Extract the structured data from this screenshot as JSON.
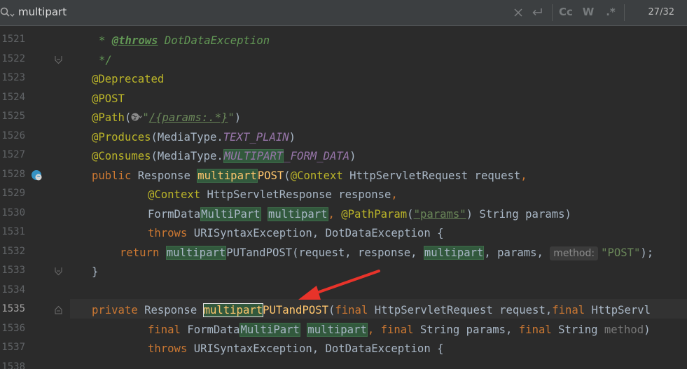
{
  "search": {
    "query": "multipart",
    "match_case_label": "Cc",
    "words_label": "W",
    "regex_label": ".*",
    "counter": "27/32"
  },
  "editor": {
    "lines": [
      {
        "n": "1521"
      },
      {
        "n": "1522"
      },
      {
        "n": "1523"
      },
      {
        "n": "1524"
      },
      {
        "n": "1525"
      },
      {
        "n": "1526"
      },
      {
        "n": "1527"
      },
      {
        "n": "1528"
      },
      {
        "n": "1529"
      },
      {
        "n": "1530"
      },
      {
        "n": "1531"
      },
      {
        "n": "1532"
      },
      {
        "n": "1533"
      },
      {
        "n": "1534"
      },
      {
        "n": "1535"
      },
      {
        "n": "1536"
      },
      {
        "n": "1537"
      },
      {
        "n": "1538"
      }
    ],
    "l1521": {
      "star": "* ",
      "tag": "@throws",
      "rest": " DotDataException"
    },
    "l1522": {
      "text": "*/"
    },
    "l1523": {
      "text": "@Deprecated"
    },
    "l1524": {
      "text": "@POST"
    },
    "l1525": {
      "ann": "@Path",
      "open": "(",
      "q1": "\"",
      "path": "/{params:.*}",
      "q2": "\"",
      "close": ")"
    },
    "l1526": {
      "ann": "@Produces",
      "pre": "(MediaType.",
      "const": "TEXT_PLAIN",
      "post": ")"
    },
    "l1527": {
      "ann": "@Consumes",
      "pre": "(MediaType.",
      "const_hl": "MULTIPART",
      "const": "_FORM_DATA",
      "post": ")"
    },
    "l1528": {
      "kw": "public",
      "type": " Response ",
      "hl": "multipart",
      "meth": "POST",
      "open": "(",
      "ann": "@Context",
      "rest": " HttpServletRequest request",
      "comma": ","
    },
    "l1529": {
      "ann": "@Context",
      "rest": " HttpServletResponse response",
      "comma": ","
    },
    "l1530": {
      "pre": "FormData",
      "hl": "MultiPart",
      "sp": " ",
      "hl2": "multipart",
      "comma": ", ",
      "ann": "@PathParam",
      "open": "(",
      "str": "\"params\"",
      "rest": ") String params)"
    },
    "l1531": {
      "kw": "throws",
      "rest": " URISyntaxException, DotDataException {"
    },
    "l1532": {
      "kw": "return",
      "sp": " ",
      "hl": "multipart",
      "m": "PUTandPOST(request, response, ",
      "hl2": "multipart",
      "rest": ", params, ",
      "hint": "method:",
      "str": "\"POST\"",
      "end": ");"
    },
    "l1533": {
      "text": "}"
    },
    "l1535": {
      "kw": "private",
      "type": " Response ",
      "hl": "multipart",
      "meth": "PUTandPOST",
      "open": "(",
      "kw2": "final",
      "rest": " HttpServletRequest request,",
      "kw3": "final",
      "rest2": " HttpServl"
    },
    "l1536": {
      "kw": "final",
      "pre": " FormData",
      "hl": "MultiPart",
      "sp": " ",
      "hl2": "multipart",
      "comma": ", ",
      "kw2": "final",
      "rest": " String params, ",
      "kw3": "final",
      "rest2": " String ",
      "gray": "method",
      "end": ")"
    },
    "l1537": {
      "kw": "throws",
      "rest": " URISyntaxException, DotDataException {"
    }
  },
  "colors": {
    "background": "#2b2b2b",
    "keyword": "#cc7832",
    "annotation": "#bbb529",
    "string": "#6a8759",
    "constant": "#9876aa",
    "method_decl": "#ffc66d",
    "search_highlight": "#32593d",
    "arrow": "#e8332a"
  }
}
